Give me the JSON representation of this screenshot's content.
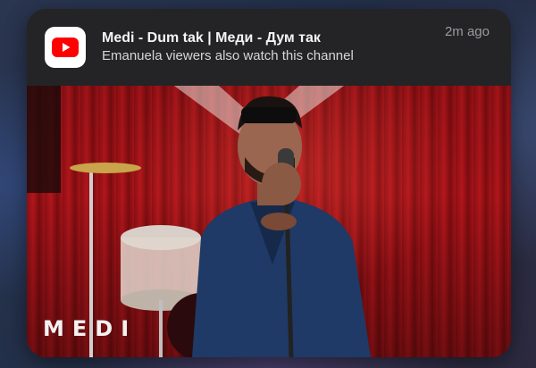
{
  "notification": {
    "app_icon": "youtube-icon",
    "title": "Medi - Dum tak | Меди - Дум так",
    "subtitle": "Emanuela viewers also watch this channel",
    "timestamp": "2m ago",
    "thumbnail": {
      "watermark": "MEDI",
      "description_icon": "singer-with-microphone"
    }
  },
  "colors": {
    "card_bg": "#232325",
    "youtube_red": "#ff0000",
    "curtain_red": "#a81419",
    "jacket_blue": "#1f3a66"
  }
}
